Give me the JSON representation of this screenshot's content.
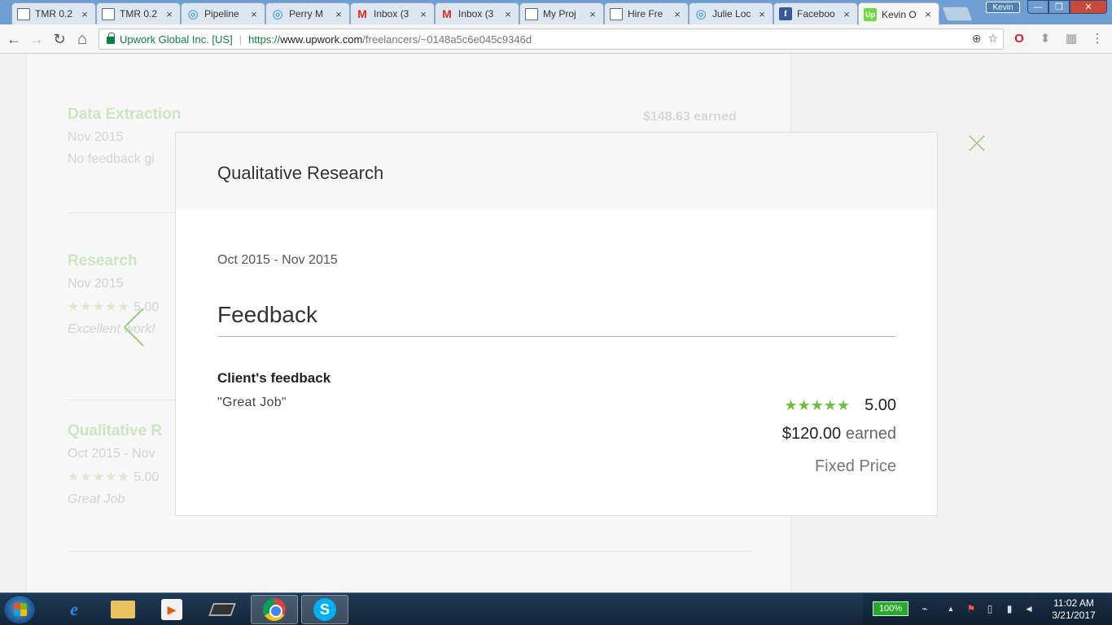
{
  "browser": {
    "tabs": [
      {
        "title": "TMR 0.2",
        "icon": "doc-icon"
      },
      {
        "title": "TMR 0.2",
        "icon": "doc-icon"
      },
      {
        "title": "Pipeline",
        "icon": "pipedrive-icon"
      },
      {
        "title": "Perry M",
        "icon": "pipedrive-icon"
      },
      {
        "title": "Inbox (3",
        "icon": "gmail-icon"
      },
      {
        "title": "Inbox (3",
        "icon": "gmail-icon"
      },
      {
        "title": "My Proj",
        "icon": "doc-icon"
      },
      {
        "title": "Hire Fre",
        "icon": "doc-icon"
      },
      {
        "title": "Julie Loc",
        "icon": "pipedrive-icon"
      },
      {
        "title": "Faceboo",
        "icon": "facebook-icon"
      },
      {
        "title": "Kevin O",
        "icon": "upwork-icon",
        "active": true
      }
    ],
    "tab_close": "×",
    "profile_name": "Kevin",
    "window_controls": {
      "minimize": "—",
      "maximize": "❐",
      "close": "✕"
    },
    "nav": {
      "back": "←",
      "forward": "→",
      "reload": "↻",
      "home": "⌂"
    },
    "address": {
      "org": "Upwork Global Inc. [US]",
      "protocol": "https://",
      "host": "www.upwork.com",
      "path": "/freelancers/~0148a5c6e045c9346d"
    },
    "omni_icons": {
      "zoom": "⊕",
      "star": "☆"
    },
    "ext_icons": {
      "opera": "O",
      "ext2": "⬍",
      "ext3": "▦",
      "menu": "⋮"
    }
  },
  "background": {
    "items": [
      {
        "title": "Data Extraction",
        "date": "Nov 2015",
        "line": "No feedback gi",
        "amount": "$148.63 earned"
      },
      {
        "title": "Research",
        "date": "Nov 2015",
        "stars": "★★★★★",
        "score": "5.00",
        "comment": "Excellent work!"
      },
      {
        "title": "Qualitative R",
        "date": "Oct 2015 - Nov",
        "stars": "★★★★★",
        "score": "5.00",
        "comment": "Great Job"
      }
    ]
  },
  "modal": {
    "title": "Qualitative Research",
    "dates": "Oct 2015 - Nov 2015",
    "feedback_heading": "Feedback",
    "client_label": "Client's feedback",
    "client_text": "\"Great Job\"",
    "stars": "★★★★★",
    "rating": "5.00",
    "amount": "$120.00",
    "earned_label": "earned",
    "price_type": "Fixed Price"
  },
  "taskbar": {
    "battery": "100%",
    "clock_time": "11:02 AM",
    "clock_date": "3/21/2017",
    "ie_glyph": "e",
    "media_glyph": "▶",
    "skype_glyph": "S",
    "tray_icons": {
      "network": "⌁",
      "expand": "▲",
      "flag": "⚑",
      "device": "▯",
      "signal": "▮",
      "volume": "◄"
    }
  },
  "colors": {
    "upwork_green": "#6fbf3a",
    "secure_green": "#0b8043"
  }
}
